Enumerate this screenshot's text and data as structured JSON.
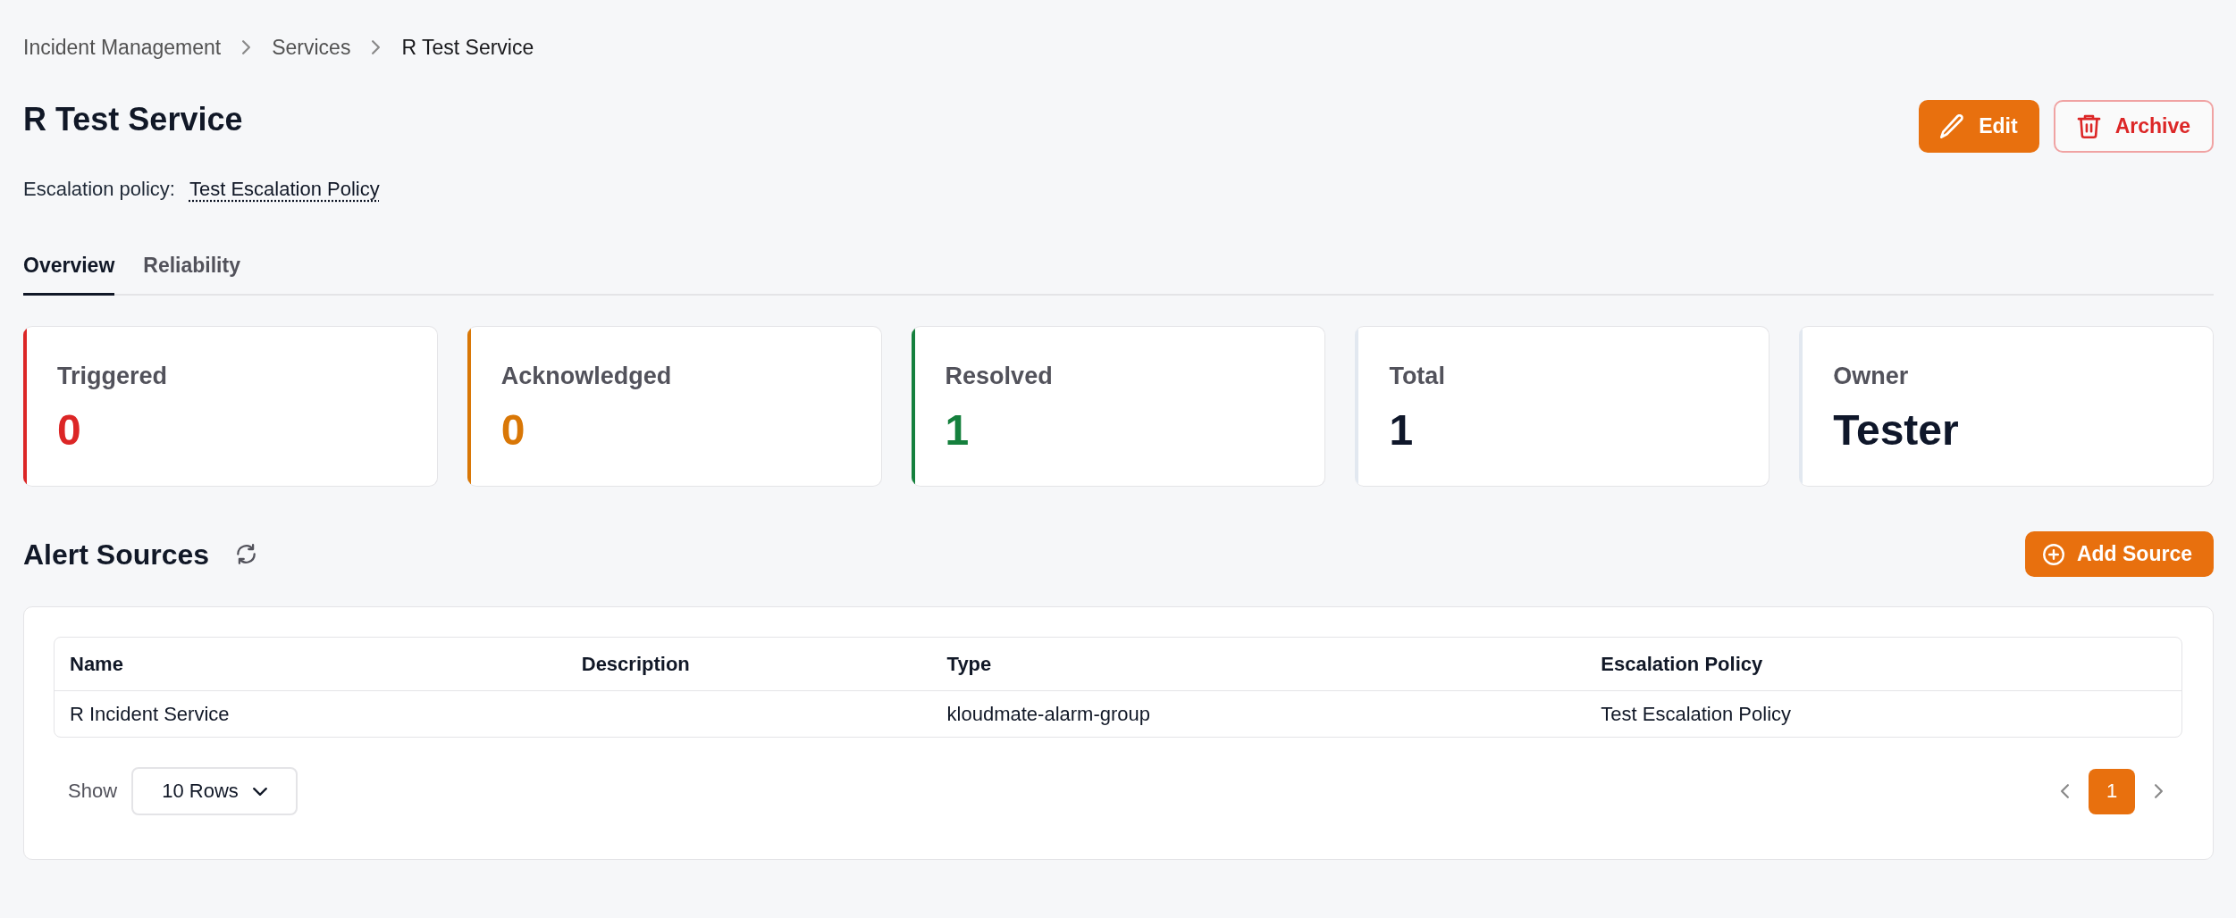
{
  "breadcrumb": [
    {
      "label": "Incident Management",
      "current": false
    },
    {
      "label": "Services",
      "current": false
    },
    {
      "label": "R Test Service",
      "current": true
    }
  ],
  "header": {
    "title": "R Test Service",
    "actions": [
      {
        "label": "Edit",
        "kind": "edit"
      },
      {
        "label": "Archive",
        "kind": "archive"
      }
    ]
  },
  "escalation_policy": {
    "label": "Escalation policy:",
    "value": "Test Escalation Policy"
  },
  "tabs": [
    {
      "label": "Overview",
      "selected": true
    },
    {
      "label": "Reliability",
      "selected": false
    }
  ],
  "stats": [
    {
      "label": "Triggered",
      "value": "0",
      "color": "#dc2626"
    },
    {
      "label": "Acknowledged",
      "value": "0",
      "color": "#d97706"
    },
    {
      "label": "Resolved",
      "value": "1",
      "color": "#15803d"
    },
    {
      "label": "Total",
      "value": "1"
    },
    {
      "label": "Owner",
      "value": "Tester"
    }
  ],
  "alert_sources": {
    "title": "Alert Sources",
    "add_button": "Add Source",
    "table": {
      "columns": [
        "Name",
        "Description",
        "Type",
        "Escalation Policy"
      ],
      "rows": [
        {
          "name": "R Incident Service",
          "type": "kloudmate-alarm-group",
          "escalation_policy": "Test Escalation Policy"
        }
      ]
    }
  },
  "pagination": {
    "show_label": "Show",
    "rows_per_page": "10 Rows",
    "pages": [
      {
        "label": "1",
        "selected": true
      }
    ]
  }
}
